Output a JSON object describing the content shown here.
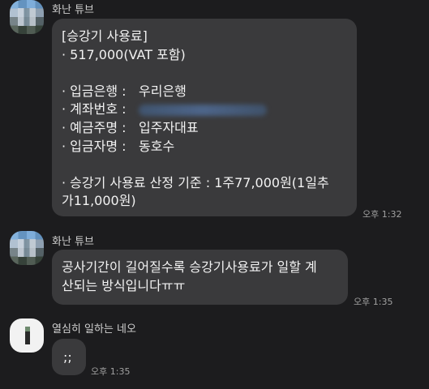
{
  "messages": [
    {
      "sender": "화난 튜브",
      "avatar_icon": "pixelated-profile-photo",
      "time": "오후 1:32",
      "lines": {
        "title": "[승강기 사용료]",
        "price": "· 517,000(VAT 포함)",
        "bank_label": "· 입금은행 :",
        "bank_value": "우리은행",
        "account_label": "· 계좌번호 :",
        "holder_label": "· 예금주명 :",
        "holder_value": "입주자대표",
        "depositor_label": "· 입금자명 :",
        "depositor_value": "동호수",
        "basis_1": "· 승강기 사용료 산정 기준 :  1주77,000원(1일추",
        "basis_2": "가11,000원)"
      }
    },
    {
      "sender": "화난 튜브",
      "avatar_icon": "pixelated-profile-photo",
      "time": "오후 1:35",
      "lines": {
        "l1": "공사기간이 길어질수록 승강기사용료가 일할 계",
        "l2": "산되는 방식입니다ㅠㅠ"
      }
    },
    {
      "sender": "열심히 일하는 네오",
      "avatar_icon": "blurred-profile-photo",
      "time": "오후 1:35",
      "lines": {
        "l1": ";;"
      }
    }
  ],
  "colors": {
    "background": "#1c1c1e",
    "bubble": "#3a3a3c",
    "text": "#f2f2f2",
    "timestamp": "#a0a0a0"
  }
}
